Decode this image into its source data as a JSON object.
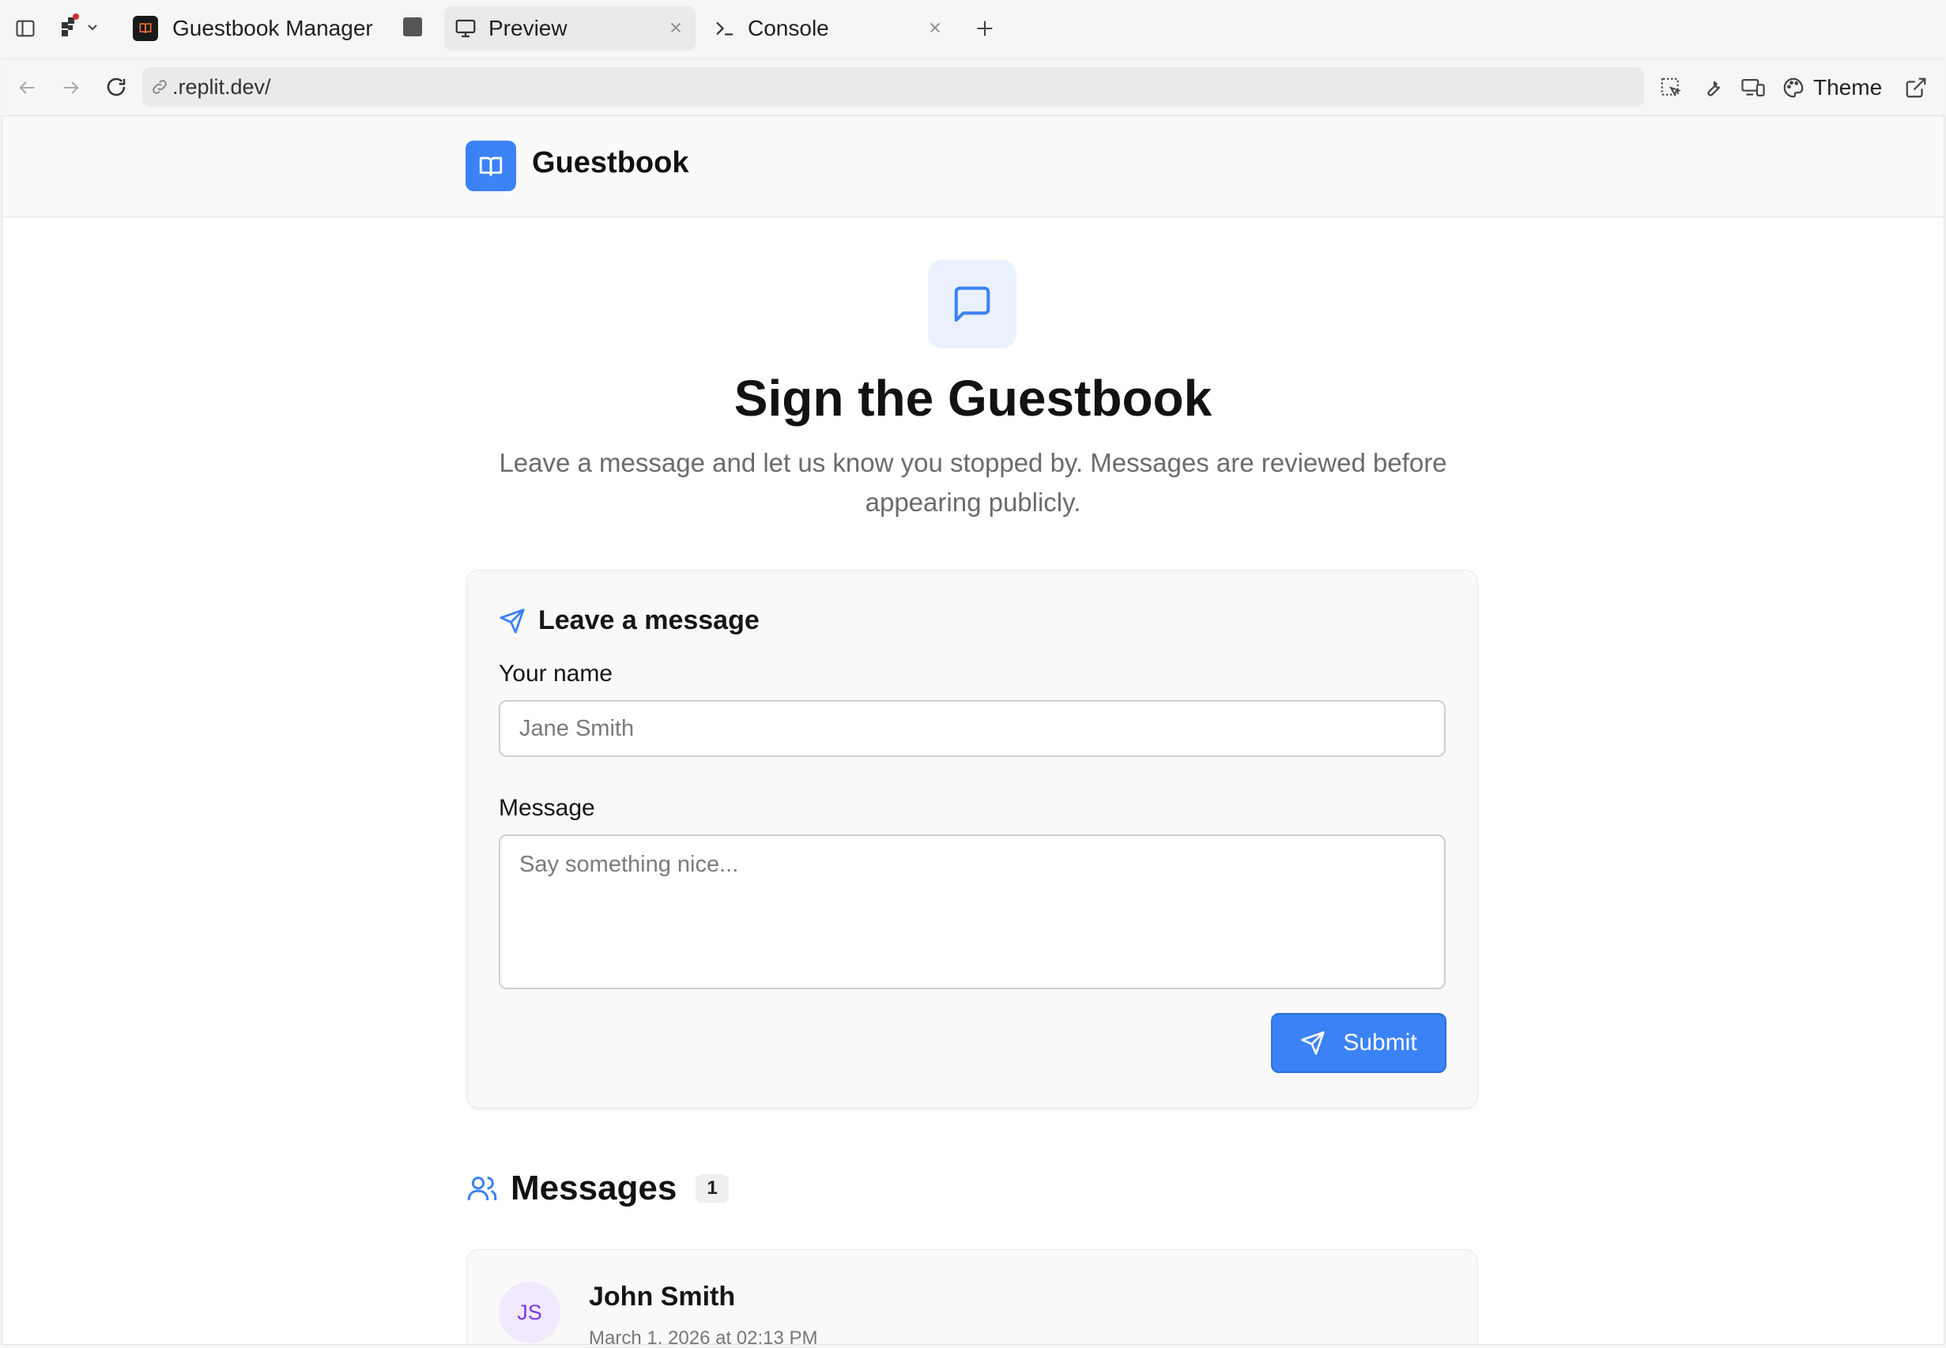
{
  "tabbar": {
    "tabs": [
      {
        "label": "Guestbook Manager"
      },
      {
        "label": "Preview"
      },
      {
        "label": "Console"
      }
    ]
  },
  "address": {
    "url": ".replit.dev/",
    "theme_label": "Theme"
  },
  "app": {
    "title": "Guestbook"
  },
  "hero": {
    "title": "Sign the Guestbook",
    "subtitle": "Leave a message and let us know you stopped by. Messages are reviewed before appearing publicly."
  },
  "form": {
    "title": "Leave a message",
    "name_label": "Your name",
    "name_placeholder": "Jane Smith",
    "message_label": "Message",
    "message_placeholder": "Say something nice...",
    "submit_label": "Submit"
  },
  "messages": {
    "title": "Messages",
    "count": "1",
    "items": [
      {
        "initials": "JS",
        "name": "John Smith",
        "date": "March 1, 2026 at 02:13 PM"
      }
    ]
  },
  "colors": {
    "accent": "#3b82f6",
    "avatar_bg": "#f1e9fd",
    "avatar_text": "#7c3aed"
  },
  "icons": {
    "sidebar_toggle": "sidebar-icon",
    "workspace": "workspace-icon",
    "preview": "monitor-icon",
    "console": "terminal-icon",
    "logo": "book-open-icon",
    "hero": "message-square-icon",
    "form": "send-icon",
    "messages": "users-icon"
  }
}
